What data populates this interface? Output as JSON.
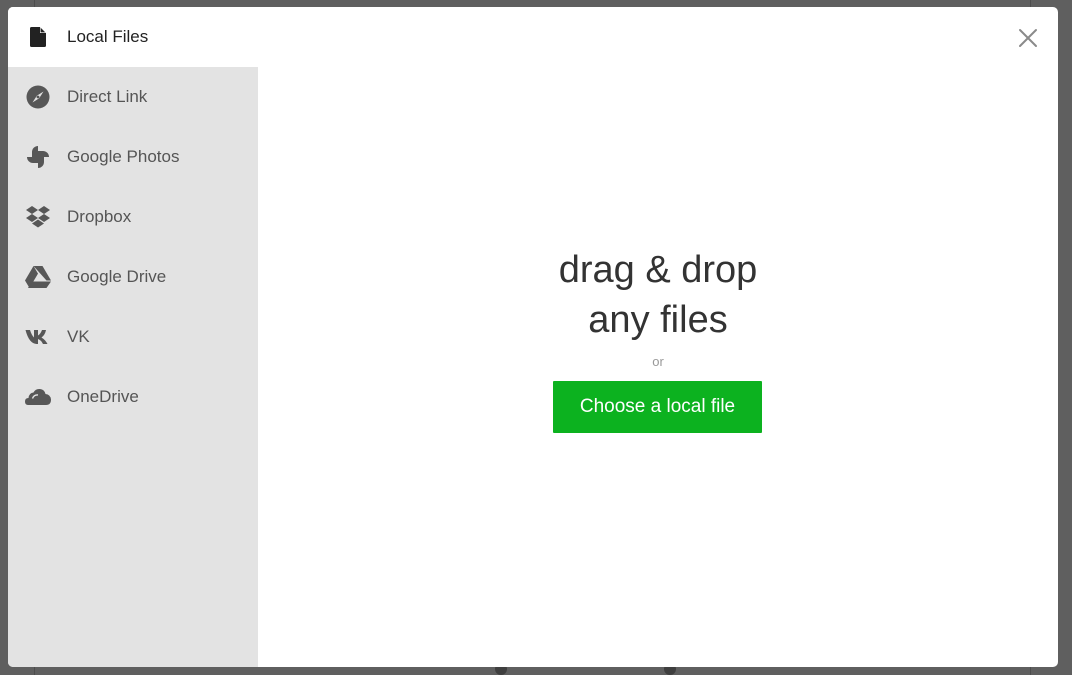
{
  "sidebar": {
    "items": [
      {
        "label": "Local Files",
        "icon": "file-icon",
        "active": true
      },
      {
        "label": "Direct Link",
        "icon": "link-compass-icon",
        "active": false
      },
      {
        "label": "Google Photos",
        "icon": "google-photos-icon",
        "active": false
      },
      {
        "label": "Dropbox",
        "icon": "dropbox-icon",
        "active": false
      },
      {
        "label": "Google Drive",
        "icon": "google-drive-icon",
        "active": false
      },
      {
        "label": "VK",
        "icon": "vk-icon",
        "active": false
      },
      {
        "label": "OneDrive",
        "icon": "onedrive-icon",
        "active": false
      }
    ]
  },
  "main": {
    "heading_line1": "drag & drop",
    "heading_line2": "any files",
    "or_text": "or",
    "choose_button_label": "Choose a local file"
  },
  "close_icon": "close-icon",
  "colors": {
    "button_bg": "#0cb21f",
    "sidebar_bg": "#e3e3e3",
    "overlay_bg": "#5f5f5f"
  }
}
